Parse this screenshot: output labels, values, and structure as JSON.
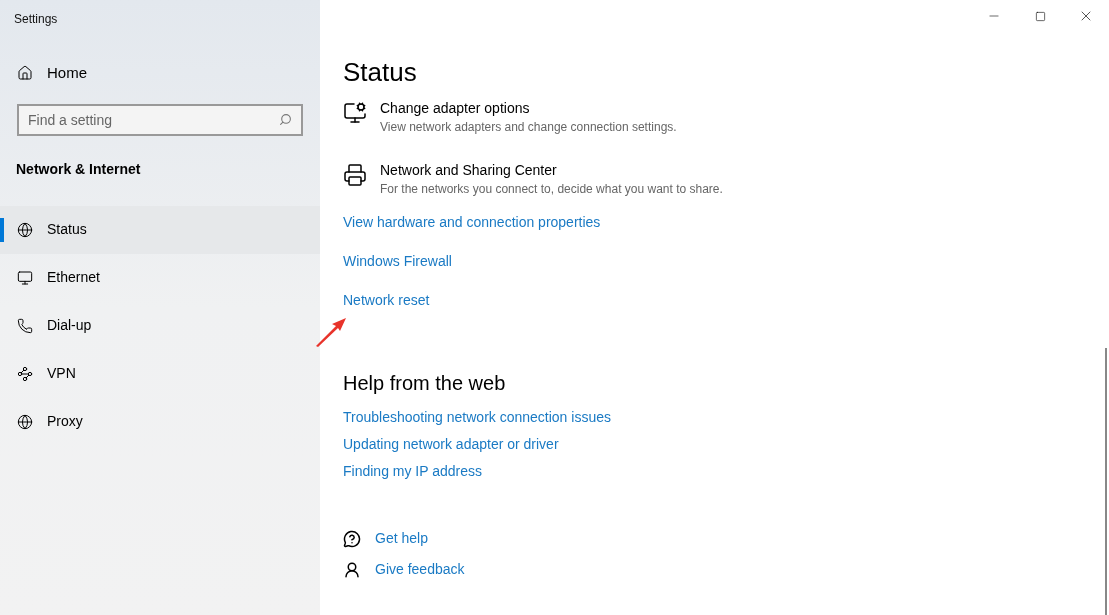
{
  "window": {
    "title": "Settings"
  },
  "sidebar": {
    "home": "Home",
    "search": {
      "placeholder": "Find a setting"
    },
    "section": "Network & Internet",
    "items": [
      {
        "label": "Status",
        "selected": true
      },
      {
        "label": "Ethernet",
        "selected": false
      },
      {
        "label": "Dial-up",
        "selected": false
      },
      {
        "label": "VPN",
        "selected": false
      },
      {
        "label": "Proxy",
        "selected": false
      }
    ]
  },
  "main": {
    "title": "Status",
    "settings": [
      {
        "title": "Change adapter options",
        "description": "View network adapters and change connection settings."
      },
      {
        "title": "Network and Sharing Center",
        "description": "For the networks you connect to, decide what you want to share."
      }
    ],
    "links": [
      "View hardware and connection properties",
      "Windows Firewall",
      "Network reset"
    ],
    "help": {
      "title": "Help from the web",
      "links": [
        "Troubleshooting network connection issues",
        "Updating network adapter or driver",
        "Finding my IP address"
      ]
    },
    "footer_links": [
      "Get help",
      "Give feedback"
    ]
  }
}
